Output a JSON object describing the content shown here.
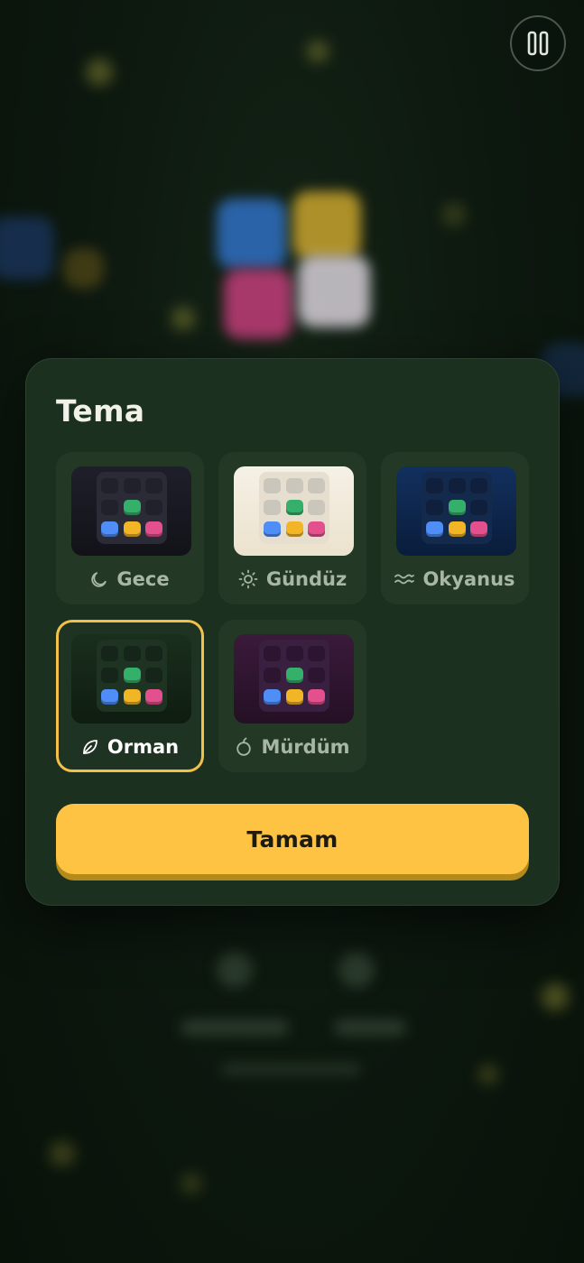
{
  "controls": {
    "pause_icon": "pause-icon"
  },
  "theme_dialog": {
    "title": "Tema",
    "themes": [
      {
        "label": "Gece",
        "icon": "moon-icon",
        "selected": false,
        "colors": {
          "bg_top": "#1f1f2b",
          "bg_bottom": "#121218",
          "board": "#2a2b36",
          "cell": "#262733"
        }
      },
      {
        "label": "Gündüz",
        "icon": "sun-icon",
        "selected": false,
        "colors": {
          "bg_top": "#f5f1e6",
          "bg_bottom": "#ece2cd",
          "board": "#e6dfd0",
          "cell": "#efe9dc"
        }
      },
      {
        "label": "Okyanus",
        "icon": "waves-icon",
        "selected": false,
        "colors": {
          "bg_top": "#12305e",
          "bg_bottom": "#0a1d3b",
          "board": "#142a4c",
          "cell": "#132646"
        }
      },
      {
        "label": "Orman",
        "icon": "leaf-icon",
        "selected": true,
        "colors": {
          "bg_top": "#1a2f1d",
          "bg_bottom": "#0f1c11",
          "board": "#1e3322",
          "cell": "#1a2c1d"
        }
      },
      {
        "label": "Mürdüm",
        "icon": "plum-icon",
        "selected": false,
        "colors": {
          "bg_top": "#3a1a3a",
          "bg_bottom": "#251025",
          "board": "#3a2040",
          "cell": "#33193a"
        }
      }
    ],
    "tile_colors": {
      "green": "#35b06b",
      "blue": "#4f8ef7",
      "yellow": "#f2b526",
      "pink": "#e4508e"
    },
    "ok_button": "Tamam",
    "accent": "#fec343",
    "selected_border": "#f2c14a"
  }
}
